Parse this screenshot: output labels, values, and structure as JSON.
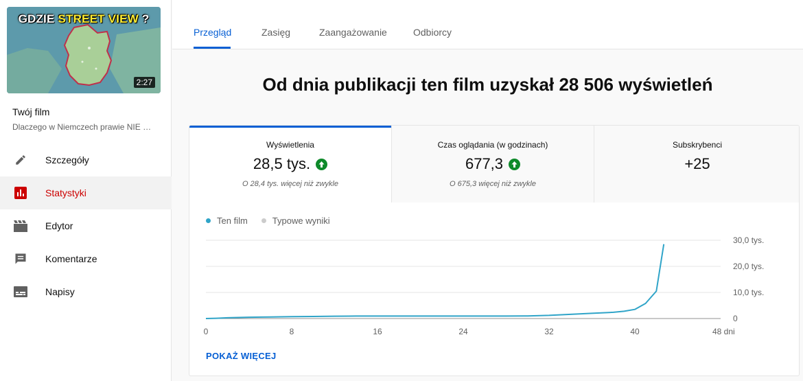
{
  "sidebar": {
    "thumbnail": {
      "title_plain": "GDZIE ",
      "title_highlight": "STREET VIEW",
      "title_suffix": " ?",
      "duration": "2:27"
    },
    "film_label": "Twój film",
    "film_title": "Dlaczego w Niemczech prawie NIE …",
    "items": [
      {
        "label": "Szczegóły",
        "icon": "pencil-icon",
        "active": false
      },
      {
        "label": "Statystyki",
        "icon": "analytics-icon",
        "active": true
      },
      {
        "label": "Edytor",
        "icon": "clapperboard-icon",
        "active": false
      },
      {
        "label": "Komentarze",
        "icon": "comment-icon",
        "active": false
      },
      {
        "label": "Napisy",
        "icon": "subtitles-icon",
        "active": false
      }
    ]
  },
  "tabs": [
    {
      "label": "Przegląd",
      "active": true
    },
    {
      "label": "Zasięg",
      "active": false
    },
    {
      "label": "Zaangażowanie",
      "active": false
    },
    {
      "label": "Odbiorcy",
      "active": false
    }
  ],
  "headline": "Od dnia publikacji ten film uzyskał 28 506 wyświetleń",
  "metrics": [
    {
      "label": "Wyświetlenia",
      "value": "28,5 tys.",
      "trend": "up",
      "note": "O 28,4 tys. więcej niż zwykle"
    },
    {
      "label": "Czas oglądania (w godzinach)",
      "value": "677,3",
      "trend": "up",
      "note": "O 675,3 więcej niż zwykle"
    },
    {
      "label": "Subskrybenci",
      "value": "+25",
      "trend": "",
      "note": ""
    }
  ],
  "colors": {
    "accent": "#065fd4",
    "active_nav": "#cc0000",
    "trend_up": "#0e8a2a",
    "series_this_film": "#2fa4c8",
    "series_typical": "#cccccc"
  },
  "show_more": "POKAŻ WIĘCEJ",
  "chart_data": {
    "type": "line",
    "xlabel": "",
    "ylabel": "",
    "x_tick_labels": [
      "0",
      "8",
      "16",
      "24",
      "32",
      "40",
      "48 dni"
    ],
    "x_ticks": [
      0,
      8,
      16,
      24,
      32,
      40,
      48
    ],
    "y_tick_labels": [
      "0",
      "10,0 tys.",
      "20,0 tys.",
      "30,0 tys."
    ],
    "y_ticks": [
      0,
      10000,
      20000,
      30000
    ],
    "xlim": [
      0,
      48
    ],
    "ylim": [
      0,
      30000
    ],
    "grid": true,
    "legend_position": "top-left",
    "series": [
      {
        "name": "Ten film",
        "x": [
          0,
          1,
          2,
          4,
          6,
          8,
          10,
          12,
          14,
          16,
          18,
          20,
          22,
          24,
          26,
          28,
          30,
          32,
          34,
          36,
          38,
          39,
          40,
          41,
          42,
          42.7
        ],
        "y": [
          0,
          100,
          300,
          500,
          600,
          750,
          800,
          900,
          950,
          950,
          950,
          950,
          950,
          950,
          950,
          950,
          1000,
          1200,
          1600,
          2000,
          2400,
          2800,
          3500,
          5800,
          10500,
          28500
        ]
      },
      {
        "name": "Typowe wyniki",
        "x": [],
        "y": []
      }
    ]
  }
}
